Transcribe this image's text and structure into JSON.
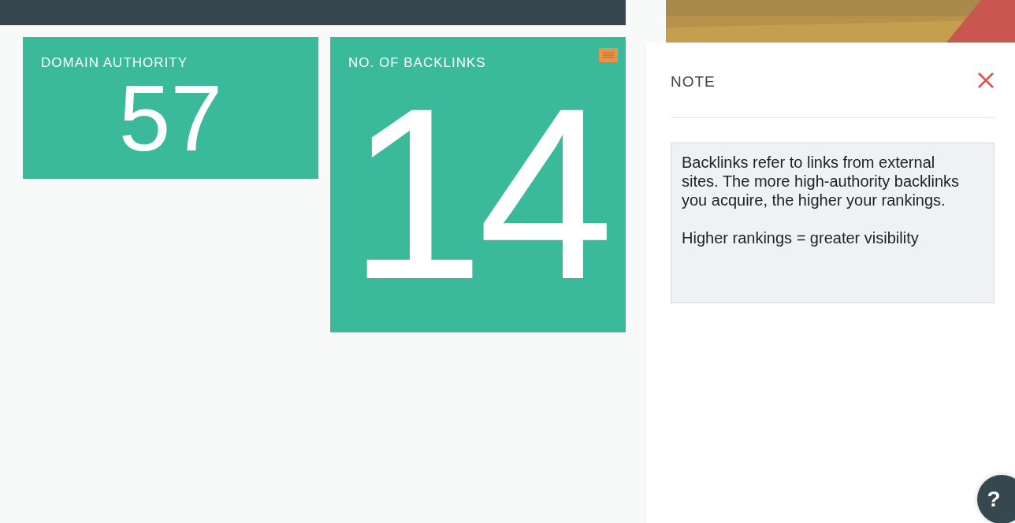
{
  "metrics": [
    {
      "label": "DOMAIN AUTHORITY",
      "value": "57",
      "kind": "compact",
      "note": false
    },
    {
      "label": "NO. OF BACKLINKS",
      "value": "14",
      "kind": "tall",
      "note": true
    }
  ],
  "note_panel": {
    "title": "NOTE",
    "paragraphs": [
      "Backlinks refer to links from external sites. The more high-authority backlinks you acquire, the higher your rankings.",
      "Higher rankings = greater visibility"
    ]
  },
  "help_button": {
    "label": "?"
  }
}
